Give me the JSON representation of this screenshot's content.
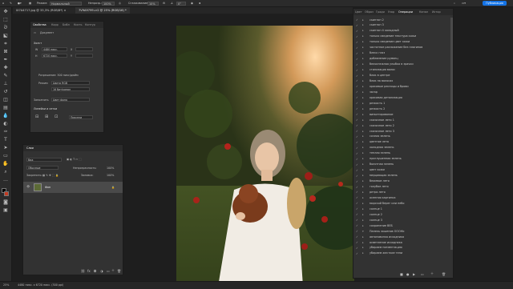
{
  "options_bar": {
    "mode_label": "Режим:",
    "mode_value": "Нормальный",
    "opacity_label": "Непрозр.:",
    "opacity_value": "100%",
    "smoothing_label": "Сглаживание:",
    "smoothing_value": "10%",
    "angle_value": "0°",
    "publish_label": "Публикация"
  },
  "tabs": [
    {
      "label": "IX7A4717.jpg @ 33,3% (RGB/8*) ×",
      "active": false
    },
    {
      "label": "7V9A9799.cr2 @ 25% (RGB/16) *",
      "active": true
    }
  ],
  "properties_panel": {
    "tabs": [
      "Свойства",
      "Корр",
      "Библ",
      "Кисть",
      "Контур"
    ],
    "doc_label": "Документ",
    "section_canvas": "Холст",
    "width_value": "4480 пикс.",
    "height_value": "6720 пикс.",
    "x_label": "X",
    "y_label": "Y",
    "resolution": "Разрешение: 300 пикс/дюйм",
    "mode_label": "Режим",
    "mode_value": "Цвета RGB",
    "depth_value": "16 бит/канал",
    "fill_label": "Заполнить",
    "fill_value": "Цвет фона",
    "section_rulers": "Линейки и сетки",
    "pixels_value": "Пиксели"
  },
  "layers_panel": {
    "tab": "Слои",
    "search_placeholder": "Вид",
    "mode_value": "Обычные",
    "opacity_label": "Непрозрачность:",
    "opacity_value": "100%",
    "lock_label": "Закрепить:",
    "fill_label": "Заливка:",
    "fill_value": "100%",
    "layer_name": "Фон"
  },
  "history_panel": {
    "tabs": [
      "Цвет",
      "Образ",
      "Гради",
      "Узор",
      "Операции",
      "Канал",
      "Истор"
    ],
    "active_tab": "Операции",
    "items": [
      {
        "name": "скинтон 2",
        "expanded": false
      },
      {
        "name": "скинтон 3",
        "expanded": false
      },
      {
        "name": "скинтон 4 холодный",
        "expanded": false
      },
      {
        "name": "только сведение текстура кожи",
        "expanded": false
      },
      {
        "name": "только сведение цвет кожи",
        "expanded": false
      },
      {
        "name": "частотное разложение без плагинов",
        "expanded": false
      },
      {
        "name": "блеск глаз",
        "expanded": false
      },
      {
        "name": "добавление румянц",
        "expanded": false
      },
      {
        "name": "белоснежная улыбка в зрачки",
        "expanded": false
      },
      {
        "name": "стилизация волос",
        "expanded": false
      },
      {
        "name": "блик в центре",
        "expanded": false
      },
      {
        "name": "блик на волосах",
        "expanded": false
      },
      {
        "name": "красивые ресницы и брови",
        "expanded": false
      },
      {
        "name": "загар",
        "expanded": false
      },
      {
        "name": "красивая детализация",
        "expanded": false
      },
      {
        "name": "резкость 1",
        "expanded": false
      },
      {
        "name": "резкость 2",
        "expanded": false
      },
      {
        "name": "виньетирование",
        "expanded": false
      },
      {
        "name": "сказочное лето 1",
        "expanded": false
      },
      {
        "name": "сказочное лето 2",
        "expanded": false
      },
      {
        "name": "сказочное лето 3",
        "expanded": false
      },
      {
        "name": "сочная зелень",
        "expanded": false
      },
      {
        "name": "цветное лето",
        "expanded": false
      },
      {
        "name": "холодная зелень",
        "expanded": false
      },
      {
        "name": "теплая зелень",
        "expanded": false
      },
      {
        "name": "приглушенная зелень",
        "expanded": false
      },
      {
        "name": "болотная зелень",
        "expanded": false
      },
      {
        "name": "цвет кожи",
        "expanded": false
      },
      {
        "name": "мерцающая зелень",
        "expanded": false
      },
      {
        "name": "бежевое лето",
        "expanded": false
      },
      {
        "name": "голубое лето",
        "expanded": false
      },
      {
        "name": "ретро лето",
        "expanded": false
      },
      {
        "name": "осенняя картинка",
        "expanded": false
      },
      {
        "name": "морской берег или небо",
        "expanded": false
      },
      {
        "name": "солнце 1",
        "expanded": false
      },
      {
        "name": "солнце 2",
        "expanded": false
      },
      {
        "name": "солнце 3",
        "expanded": false
      },
      {
        "name": "сохранение ВЕБ",
        "expanded": false
      },
      {
        "name": "Панель экшенов OOOHb",
        "expanded": true
      },
      {
        "name": "автоновинка исходника",
        "expanded": false
      },
      {
        "name": "осветление исходника",
        "expanded": false
      },
      {
        "name": "убираем пигментацию",
        "expanded": false
      },
      {
        "name": "убираем жесткие тени",
        "expanded": false
      }
    ]
  },
  "status_bar": {
    "zoom": "25%",
    "info": "4480 пикс. x 6720 пикс. (300 ppi)"
  }
}
